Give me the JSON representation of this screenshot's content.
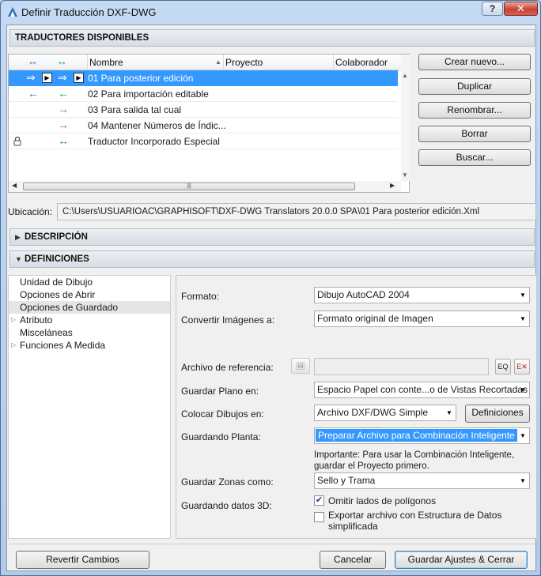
{
  "window": {
    "title": "Definir Traducción DXF-DWG",
    "help_label": "?",
    "close_label": "✕"
  },
  "translators": {
    "header": "TRADUCTORES DISPONIBLES",
    "columns": {
      "name": "Nombre",
      "project": "Proyecto",
      "collaborator": "Colaborador"
    },
    "col_arrow_1": "↔",
    "col_arrow_2": "↔",
    "rows": [
      {
        "name": "01 Para posterior edición",
        "arrow1": "⇒",
        "arrow2": "⇒",
        "selected": true
      },
      {
        "name": "02 Para importación editable",
        "arrow1": "←",
        "arrow2": "←",
        "selected": false
      },
      {
        "name": "03 Para salida tal cual",
        "arrow1": "",
        "arrow2": "→",
        "selected": false
      },
      {
        "name": "04 Mantener Números de Índic...",
        "arrow1": "",
        "arrow2": "→",
        "selected": false
      },
      {
        "name": "Traductor Incorporado Especial",
        "arrow1": "🔒",
        "arrow2": "↔",
        "selected": false
      }
    ],
    "buttons": {
      "create": "Crear nuevo...",
      "duplicate": "Duplicar",
      "rename": "Renombrar...",
      "delete": "Borrar",
      "find": "Buscar..."
    }
  },
  "location": {
    "label": "Ubicación:",
    "path": "C:\\Users\\USUARIOAC\\GRAPHISOFT\\DXF-DWG Translators 20.0.0 SPA\\01 Para posterior edición.Xml"
  },
  "description": {
    "header": "DESCRIPCIÓN"
  },
  "definitions": {
    "header": "DEFINICIONES",
    "tree": [
      {
        "label": "Unidad de Dibujo",
        "expandable": false,
        "active": false
      },
      {
        "label": "Opciones de Abrir",
        "expandable": false,
        "active": false
      },
      {
        "label": "Opciones de Guardado",
        "expandable": false,
        "active": true
      },
      {
        "label": "Atributo",
        "expandable": true,
        "active": false
      },
      {
        "label": "Misceláneas",
        "expandable": false,
        "active": false
      },
      {
        "label": "Funciones A Medida",
        "expandable": true,
        "active": false
      }
    ],
    "format": {
      "label": "Formato:",
      "value": "Dibujo AutoCAD 2004"
    },
    "images": {
      "label": "Convertir Imágenes a:",
      "value": "Formato original de Imagen"
    },
    "reference": {
      "label": "Archivo de referencia:"
    },
    "save_plan": {
      "label": "Guardar Plano en:",
      "value": "Espacio Papel con conte...o de Vistas Recortadas"
    },
    "place_drawings": {
      "label": "Colocar Dibujos en:",
      "value": "Archivo DXF/DWG Simple",
      "button": "Definiciones"
    },
    "saving_floor": {
      "label": "Guardando Planta:",
      "value": "Preparar Archivo para Combinación Inteligente"
    },
    "note_line1": "Importante: Para usar la Combinación Inteligente,",
    "note_line2": "guardar el Proyecto primero.",
    "save_zones": {
      "label": "Guardar Zonas como:",
      "value": "Sello y Trama"
    },
    "saving_3d": {
      "label": "Guardando datos 3D:",
      "omit_label": "Omitir lados de polígonos",
      "omit_checked": true,
      "export_line1": "Exportar archivo con Estructura de Datos",
      "export_line2": "simplificada",
      "export_checked": false
    }
  },
  "footer": {
    "revert": "Revertir Cambios",
    "cancel": "Cancelar",
    "save_close": "Guardar Ajustes & Cerrar"
  },
  "colors": {
    "selection": "#3399ff",
    "title_bg": "#b9d1ec",
    "close_red": "#c5433a"
  }
}
